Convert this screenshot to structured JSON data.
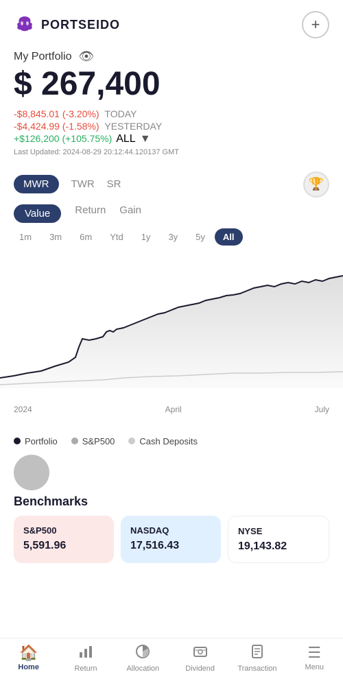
{
  "header": {
    "logo_text": "PORTSEIDO",
    "add_button_label": "+"
  },
  "portfolio": {
    "title": "My Portfolio",
    "value": "$ 267,400",
    "change_today": "-$8,845.01 (-3.20%)",
    "change_today_label": "TODAY",
    "change_yesterday": "-$4,424.99 (-1.58%)",
    "change_yesterday_label": "YESTERDAY",
    "change_all": "+$126,200 (+105.75%)",
    "change_all_label": "ALL",
    "last_updated": "Last Updated: 2024-08-29 20:12:44.120137 GMT"
  },
  "metric_tabs": {
    "items": [
      "MWR",
      "TWR",
      "SR"
    ],
    "active": "MWR"
  },
  "sub_tabs": {
    "items": [
      "Value",
      "Return",
      "Gain"
    ],
    "active": "Value"
  },
  "time_range": {
    "items": [
      "1m",
      "3m",
      "6m",
      "Ytd",
      "1y",
      "3y",
      "5y",
      "All"
    ],
    "active": "All"
  },
  "chart": {
    "x_labels": [
      "2024",
      "April",
      "July"
    ]
  },
  "legend": {
    "items": [
      {
        "label": "Portfolio",
        "color": "#1a1a2e"
      },
      {
        "label": "S&P500",
        "color": "#aaaaaa"
      },
      {
        "label": "Cash Deposits",
        "color": "#cccccc"
      }
    ]
  },
  "benchmarks": {
    "title": "Benchmarks",
    "items": [
      {
        "name": "S&P500",
        "value": "5,591.96",
        "style": "pink"
      },
      {
        "name": "NASDAQ",
        "value": "17,516.43",
        "style": "blue-light"
      },
      {
        "name": "NYSE",
        "value": "19,143.82",
        "style": "white"
      }
    ]
  },
  "bottom_nav": {
    "items": [
      {
        "label": "Home",
        "icon": "🏠",
        "active": true
      },
      {
        "label": "Return",
        "icon": "📊",
        "active": false
      },
      {
        "label": "Allocation",
        "icon": "🥧",
        "active": false
      },
      {
        "label": "Dividend",
        "icon": "💰",
        "active": false
      },
      {
        "label": "Transaction",
        "icon": "📄",
        "active": false
      },
      {
        "label": "Menu",
        "icon": "☰",
        "active": false
      }
    ]
  }
}
